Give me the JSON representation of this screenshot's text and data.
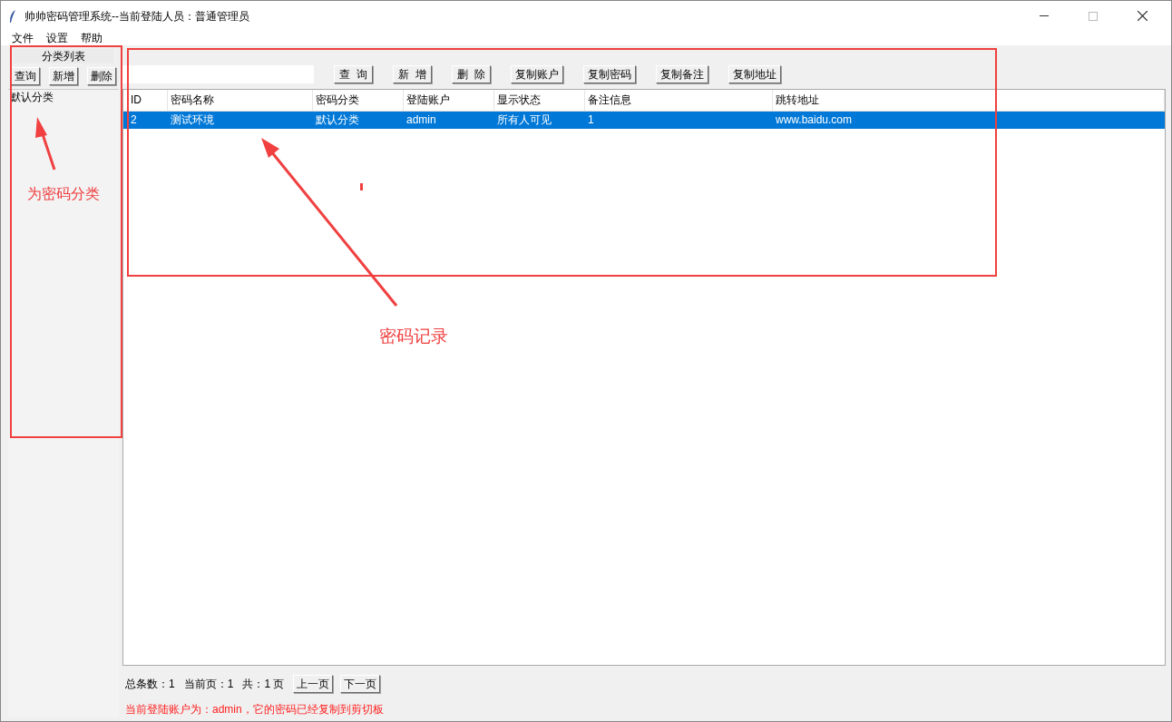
{
  "window": {
    "title": "帅帅密码管理系统--当前登陆人员：普通管理员"
  },
  "menu": [
    "文件",
    "设置",
    "帮助"
  ],
  "sidebar": {
    "title": "分类列表",
    "buttons": [
      "查询",
      "新增",
      "删除"
    ],
    "items": [
      {
        "label": "默认分类",
        "selected": false
      }
    ]
  },
  "toolbar": {
    "buttons": [
      "查  询",
      "新  增",
      "删  除",
      "复制账户",
      "复制密码",
      "复制备注",
      "复制地址"
    ]
  },
  "table": {
    "columns": [
      "ID",
      "密码名称",
      "密码分类",
      "登陆账户",
      "显示状态",
      "备注信息",
      "跳转地址"
    ],
    "rows": [
      {
        "selected": true,
        "cells": [
          "2",
          "测试环境",
          "默认分类",
          "admin",
          "所有人可见",
          "1",
          "www.baidu.com"
        ]
      }
    ]
  },
  "pager": {
    "texts": [
      "总条数：1",
      "当前页：1",
      "共：1 页"
    ],
    "buttons": [
      "上一页",
      "下一页"
    ]
  },
  "status_message": "当前登陆账户为：admin，它的密码已经复制到剪切板",
  "annotations": [
    {
      "label": "为密码分类"
    },
    {
      "label": "密码记录"
    }
  ]
}
